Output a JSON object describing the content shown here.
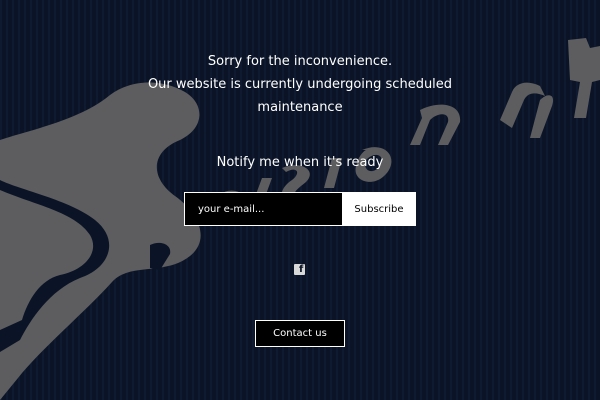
{
  "maintenance": {
    "line_1": "Sorry for the inconvenience.",
    "line_2": "Our website is currently undergoing scheduled",
    "line_3": "maintenance"
  },
  "notify": {
    "heading": "Notify me when it's ready",
    "email_placeholder": "your e-mail...",
    "subscribe_label": "Subscribe"
  },
  "social": {
    "facebook_icon": "facebook-icon"
  },
  "contact": {
    "label": "Contact us"
  },
  "colors": {
    "background": "#0b1426",
    "logo_gray": "#5d5d5f",
    "text": "#ffffff"
  }
}
